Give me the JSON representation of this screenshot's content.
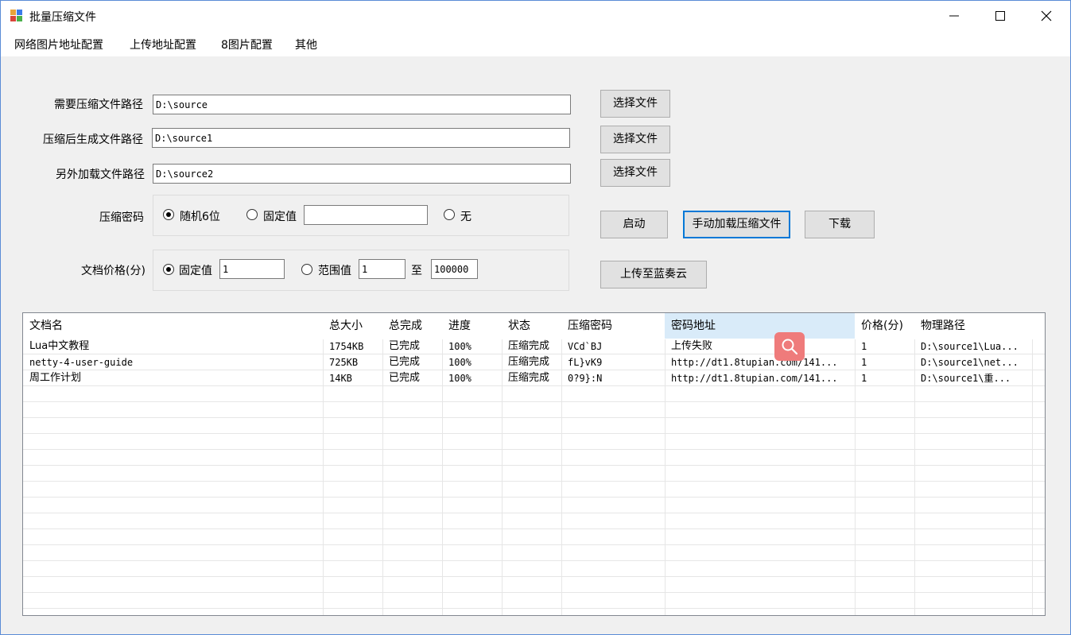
{
  "window": {
    "title": "批量压缩文件"
  },
  "menu": [
    "网络图片地址配置",
    "上传地址配置",
    "8图片配置",
    "其他"
  ],
  "form": {
    "source_path_label": "需要压缩文件路径",
    "source_path_value": "D:\\source",
    "output_path_label": "压缩后生成文件路径",
    "output_path_value": "D:\\source1",
    "extra_path_label": "另外加载文件路径",
    "extra_path_value": "D:\\source2",
    "choose_file_label": "选择文件",
    "password_label": "压缩密码",
    "password_random": "随机6位",
    "password_fixed": "固定值",
    "password_fixed_value": "",
    "password_none": "无",
    "price_label": "文档价格(分)",
    "price_fixed": "固定值",
    "price_fixed_value": "1",
    "price_range": "范围值",
    "price_range_min": "1",
    "price_to": "至",
    "price_range_max": "100000"
  },
  "actions": {
    "start": "启动",
    "manual_load": "手动加载压缩文件",
    "download": "下载",
    "upload": "上传至蓝奏云"
  },
  "table": {
    "headers": [
      "文档名",
      "总大小",
      "总完成",
      "进度",
      "状态",
      "压缩密码",
      "密码地址",
      "价格(分)",
      "物理路径"
    ],
    "rows": [
      [
        "Lua中文教程",
        "1754KB",
        "已完成",
        "100%",
        "压缩完成",
        "VCd`BJ",
        "上传失败",
        "1",
        "D:\\source1\\Lua..."
      ],
      [
        "netty-4-user-guide",
        "725KB",
        "已完成",
        "100%",
        "压缩完成",
        "fL}vK9",
        "http://dt1.8tupian.com/141...",
        "1",
        "D:\\source1\\net..."
      ],
      [
        "周工作计划",
        "14KB",
        "已完成",
        "100%",
        "压缩完成",
        "0?9}:N",
        "http://dt1.8tupian.com/141...",
        "1",
        "D:\\source1\\重..."
      ]
    ]
  },
  "icons": {
    "app": "app-icon",
    "minimize": "minimize-icon",
    "maximize": "maximize-icon",
    "close": "close-icon",
    "search": "search-icon"
  },
  "colors": {
    "accent": "#0078d7",
    "selected_header": "#d9ebf9",
    "overlay": "#ef7b7b"
  }
}
